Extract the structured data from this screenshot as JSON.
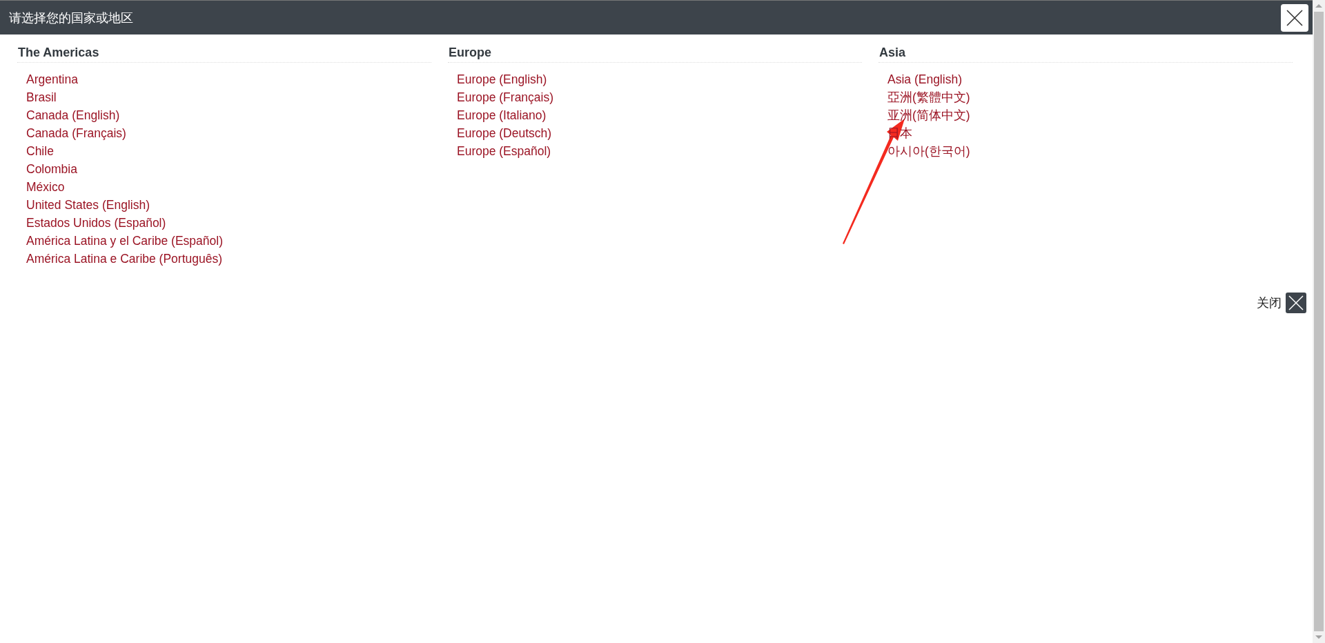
{
  "dialog": {
    "title": "请选择您的国家或地区"
  },
  "regions": [
    {
      "heading": "The Americas",
      "links": [
        "Argentina",
        "Brasil",
        "Canada (English)",
        "Canada (Français)",
        "Chile",
        "Colombia",
        "México",
        "United States (English)",
        "Estados Unidos (Español)",
        "América Latina y el Caribe (Español)",
        "América Latina e Caribe (Português)"
      ]
    },
    {
      "heading": "Europe",
      "links": [
        "Europe (English)",
        "Europe (Français)",
        "Europe (Italiano)",
        "Europe (Deutsch)",
        "Europe (Español)"
      ]
    },
    {
      "heading": "Asia",
      "links": [
        "Asia (English)",
        "亞洲(繁體中文)",
        "亚洲(简体中文)",
        "日本",
        "아시아(한국어)"
      ]
    }
  ],
  "footer": {
    "close_label": "关闭"
  }
}
